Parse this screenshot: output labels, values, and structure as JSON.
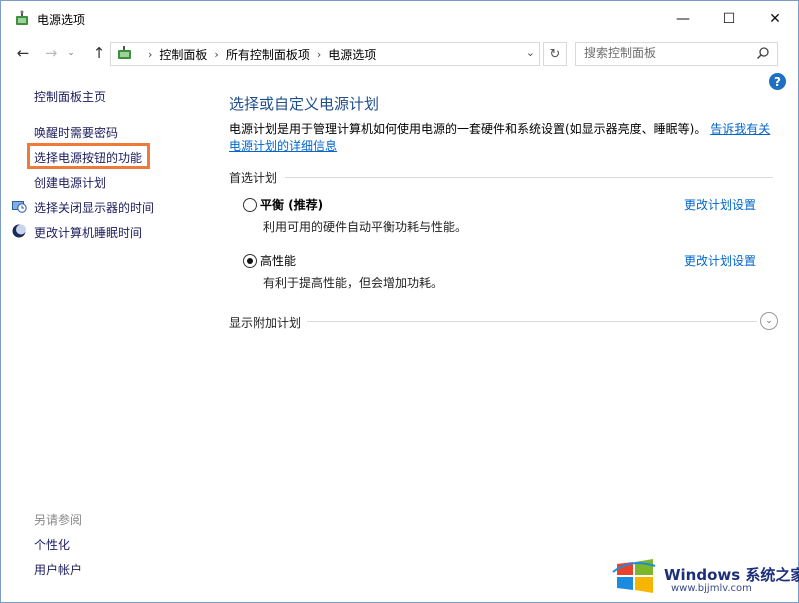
{
  "window": {
    "title": "电源选项",
    "minimize": "—",
    "maximize": "☐",
    "close": "✕"
  },
  "nav": {
    "back": "←",
    "forward": "→",
    "up": "↑"
  },
  "breadcrumbs": [
    "控制面板",
    "所有控制面板项",
    "电源选项"
  ],
  "search": {
    "placeholder": "搜索控制面板"
  },
  "help": "?",
  "sidebar": {
    "home": "控制面板主页",
    "items": [
      {
        "label": "唤醒时需要密码",
        "icon": ""
      },
      {
        "label": "选择电源按钮的功能",
        "icon": "",
        "highlighted": true
      },
      {
        "label": "创建电源计划",
        "icon": ""
      },
      {
        "label": "选择关闭显示器的时间",
        "icon": "monitor-clock-icon"
      },
      {
        "label": "更改计算机睡眠时间",
        "icon": "moon-icon"
      }
    ],
    "see_also": "另请参阅",
    "see_also_items": [
      "个性化",
      "用户帐户"
    ]
  },
  "main": {
    "heading": "选择或自定义电源计划",
    "description": "电源计划是用于管理计算机如何使用电源的一套硬件和系统设置(如显示器亮度、睡眠等)。",
    "description_link": "告诉我有关电源计划的详细信息",
    "preferred_section": "首选计划",
    "plans": [
      {
        "name": "平衡 (推荐)",
        "desc": "利用可用的硬件自动平衡功耗与性能。",
        "selected": false,
        "change": "更改计划设置"
      },
      {
        "name": "高性能",
        "desc": "有利于提高性能，但会增加功耗。",
        "selected": true,
        "change": "更改计划设置"
      }
    ],
    "additional_section": "显示附加计划"
  },
  "watermark": {
    "title": "Windows 系统之家",
    "url": "www.bjjmlv.com"
  }
}
